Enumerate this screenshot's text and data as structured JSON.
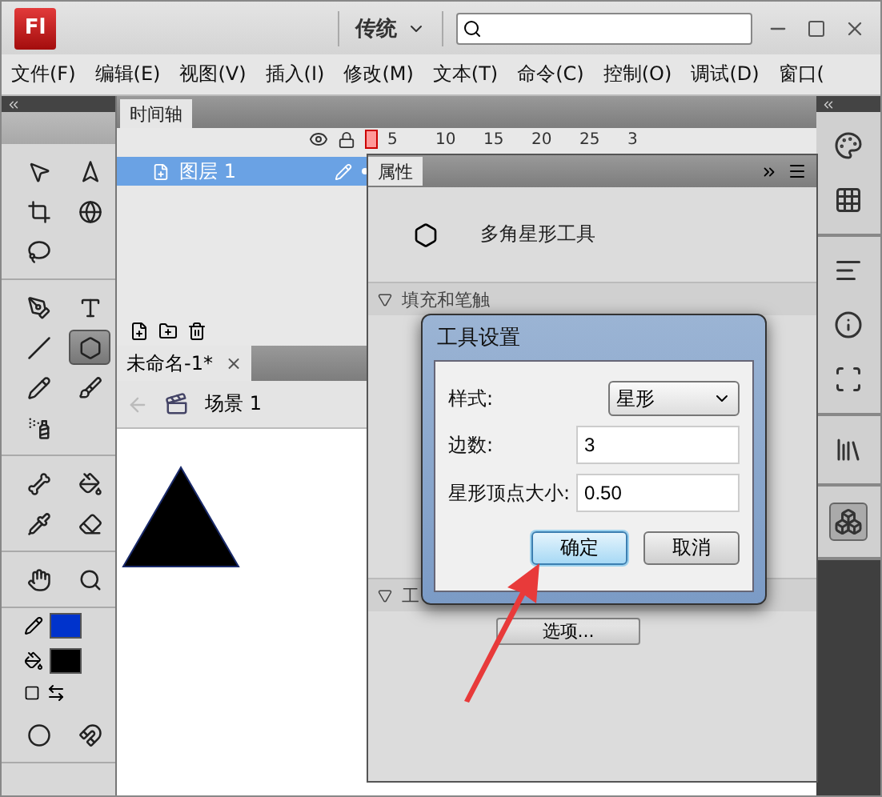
{
  "app": {
    "logo": "Fl",
    "workspace": "传统"
  },
  "menu": [
    "文件(F)",
    "编辑(E)",
    "视图(V)",
    "插入(I)",
    "修改(M)",
    "文本(T)",
    "命令(C)",
    "控制(O)",
    "调试(D)",
    "窗口("
  ],
  "tools": [
    {
      "selected": false
    },
    {
      "selected": false
    },
    {
      "selected": false
    },
    {
      "selected": false
    },
    {
      "selected": false
    },
    {
      "selected": false
    },
    {
      "selected": false
    },
    {
      "selected": false
    },
    {
      "selected": true
    },
    {
      "selected": false
    },
    {
      "selected": false
    },
    {
      "selected": false
    },
    {
      "selected": false
    },
    {
      "selected": false
    },
    {
      "selected": false
    },
    {
      "selected": false
    },
    {
      "selected": false
    },
    {
      "selected": false
    },
    {
      "selected": false
    },
    {
      "selected": false
    }
  ],
  "swatches": [
    {
      "color": "#0033cc"
    },
    {
      "color": "#000000"
    }
  ],
  "timeline": {
    "tab": "时间轴",
    "frames": [
      "5",
      "10",
      "15",
      "20",
      "25",
      "3"
    ],
    "layers": [
      {
        "name": "图层 1",
        "selected": true
      }
    ]
  },
  "document": {
    "tab": "未命名-1*",
    "close": "×",
    "scene": "场景 1"
  },
  "properties": {
    "tab": "属性",
    "tool_name": "多角星形工具",
    "sections": [
      {
        "title": "填充和笔触",
        "expanded": true
      },
      {
        "title": "工",
        "expanded": true
      }
    ],
    "options_button": "选项..."
  },
  "dialog": {
    "title": "工具设置",
    "fields": [
      {
        "kind": "select",
        "label": "样式:",
        "value": "星形"
      },
      {
        "kind": "text",
        "label": "边数:",
        "value": "3"
      },
      {
        "kind": "text",
        "label": "星形顶点大小:",
        "value": "0.50"
      }
    ],
    "buttons": [
      {
        "label": "确定",
        "focused": true
      },
      {
        "label": "取消",
        "focused": false
      }
    ]
  }
}
